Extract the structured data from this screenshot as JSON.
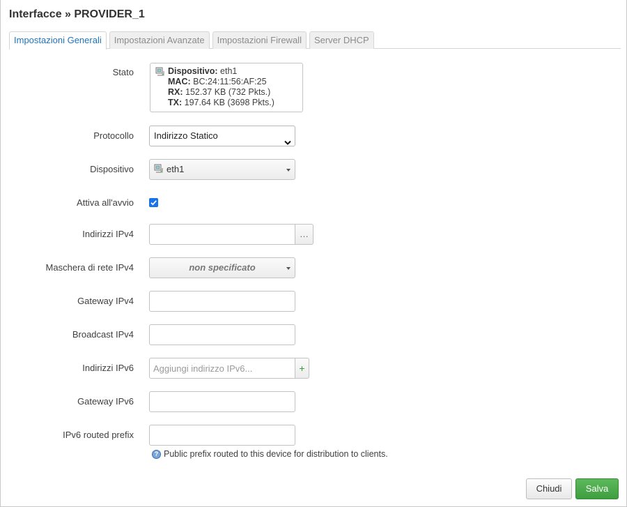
{
  "dialog": {
    "title": "Interfacce » PROVIDER_1"
  },
  "tabs": [
    {
      "label": "Impostazioni Generali",
      "active": true
    },
    {
      "label": "Impostazioni Avanzate",
      "active": false
    },
    {
      "label": "Impostazioni Firewall",
      "active": false
    },
    {
      "label": "Server DHCP",
      "active": false
    }
  ],
  "fields": {
    "stato": {
      "label": "Stato",
      "device_key": "Dispositivo:",
      "device_val": "eth1",
      "mac_key": "MAC:",
      "mac_val": "BC:24:11:56:AF:25",
      "rx_key": "RX:",
      "rx_val": "152.37 KB (732 Pkts.)",
      "tx_key": "TX:",
      "tx_val": "197.64 KB (3698 Pkts.)"
    },
    "protocollo": {
      "label": "Protocollo",
      "value": "Indirizzo Statico"
    },
    "dispositivo": {
      "label": "Dispositivo",
      "value": "eth1"
    },
    "attiva": {
      "label": "Attiva all'avvio",
      "checked": true
    },
    "ipv4_addr": {
      "label": "Indirizzi IPv4",
      "value": "",
      "button": "…"
    },
    "ipv4_mask": {
      "label": "Maschera di rete IPv4",
      "value": "non specificato"
    },
    "ipv4_gw": {
      "label": "Gateway IPv4",
      "value": ""
    },
    "ipv4_bcast": {
      "label": "Broadcast IPv4",
      "value": ""
    },
    "ipv6_addr": {
      "label": "Indirizzi IPv6",
      "placeholder": "Aggiungi indirizzo IPv6...",
      "button": "+"
    },
    "ipv6_gw": {
      "label": "Gateway IPv6",
      "value": ""
    },
    "ipv6_prefix": {
      "label": "IPv6 routed prefix",
      "value": "",
      "hint": "Public prefix routed to this device for distribution to clients."
    }
  },
  "footer": {
    "close_label": "Chiudi",
    "save_label": "Salva"
  },
  "colors": {
    "accent": "#1e73be",
    "save": "#4cae4c",
    "checkbox": "#1a73e8"
  }
}
